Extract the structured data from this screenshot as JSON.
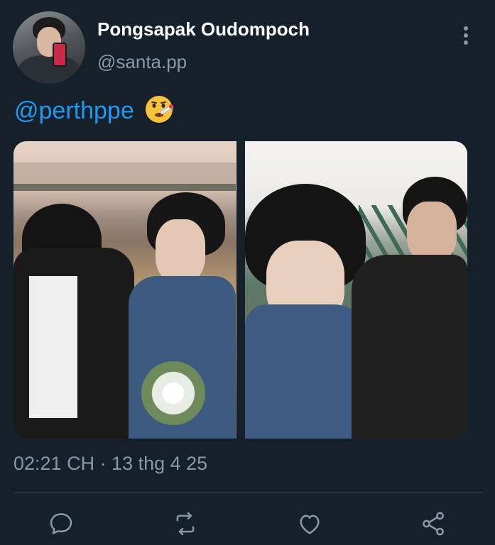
{
  "header": {
    "display_name": "Pongsapak Oudompoch",
    "handle": "@santa.pp",
    "more_icon": "more-vertical-icon",
    "avatar_icon": "profile-photo"
  },
  "tweet": {
    "mention": "@perthppe",
    "emoji": "face-with-thermometer",
    "media_count": 2
  },
  "meta": {
    "timestamp": "02:21 CH · 13 thg 4 25"
  },
  "actions": {
    "reply_icon": "reply-icon",
    "retweet_icon": "retweet-icon",
    "like_icon": "heart-icon",
    "share_icon": "share-icon"
  },
  "colors": {
    "background": "#15202b",
    "text_primary": "#ffffff",
    "text_secondary": "#8899a6",
    "accent": "#1d9bf0",
    "divider": "#38444d"
  }
}
